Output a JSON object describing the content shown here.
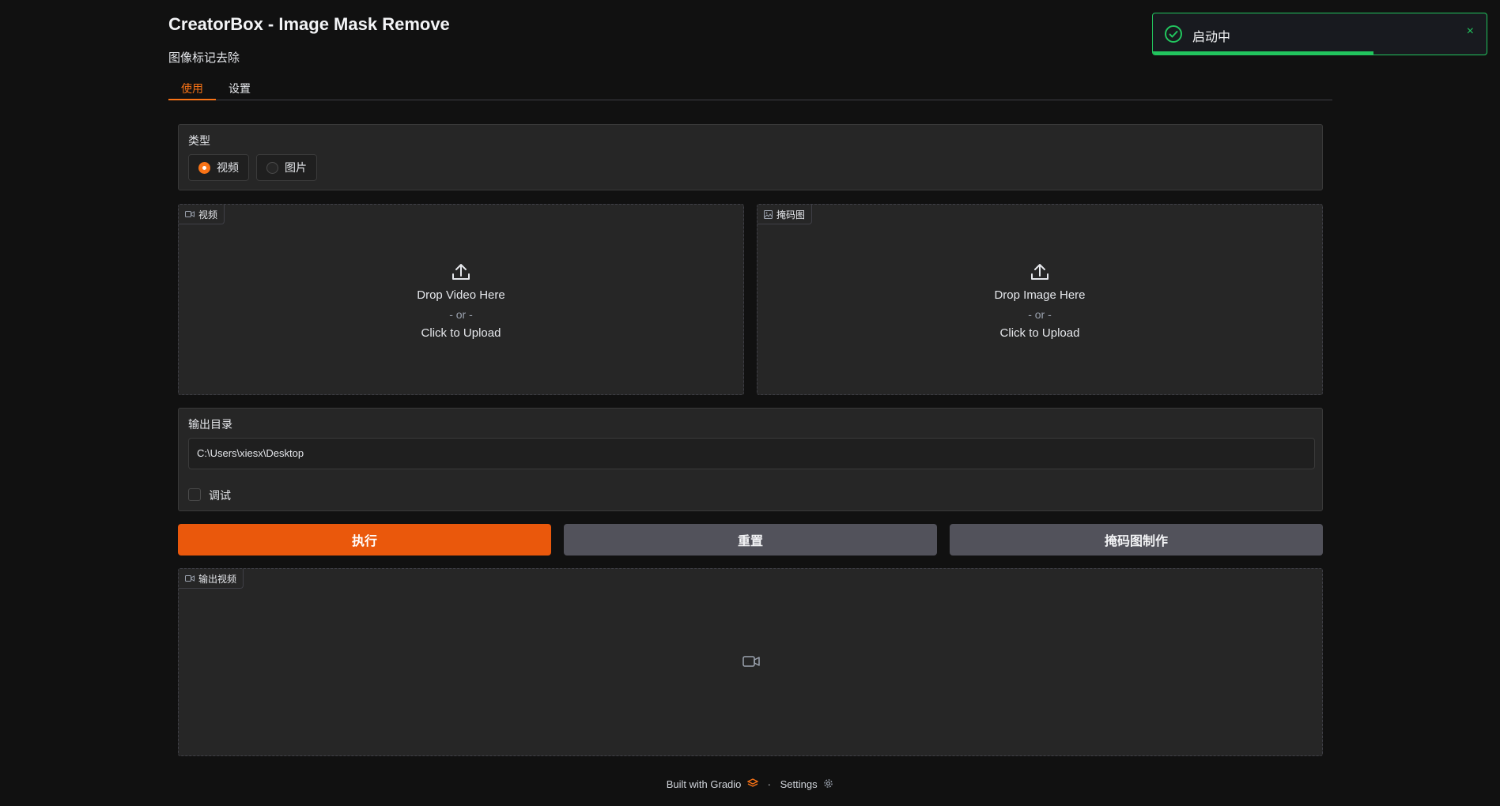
{
  "app": {
    "title": "CreatorBox - Image Mask Remove",
    "subtitle": "图像标记去除"
  },
  "tabs": [
    {
      "label": "使用",
      "active": true
    },
    {
      "label": "设置",
      "active": false
    }
  ],
  "type_group": {
    "label": "类型",
    "options": [
      {
        "label": "视频",
        "checked": true
      },
      {
        "label": "图片",
        "checked": false
      }
    ]
  },
  "video_upload": {
    "tag": "视频",
    "drop_text": "Drop Video Here",
    "or_text": "- or -",
    "click_text": "Click to Upload"
  },
  "mask_upload": {
    "tag": "掩码图",
    "drop_text": "Drop Image Here",
    "or_text": "- or -",
    "click_text": "Click to Upload"
  },
  "output_dir": {
    "label": "输出目录",
    "value": "C:\\Users\\xiesx\\Desktop"
  },
  "debug": {
    "label": "调试",
    "checked": false
  },
  "buttons": {
    "run": "执行",
    "reset": "重置",
    "mask_make": "掩码图制作"
  },
  "output_video": {
    "tag": "输出视频"
  },
  "footer": {
    "built_with": "Built with Gradio",
    "separator": "·",
    "settings": "Settings"
  },
  "toast": {
    "text": "启动中",
    "close": "×",
    "progress": 0.66
  },
  "colors": {
    "accent": "#ea580c",
    "success": "#22c55e"
  }
}
